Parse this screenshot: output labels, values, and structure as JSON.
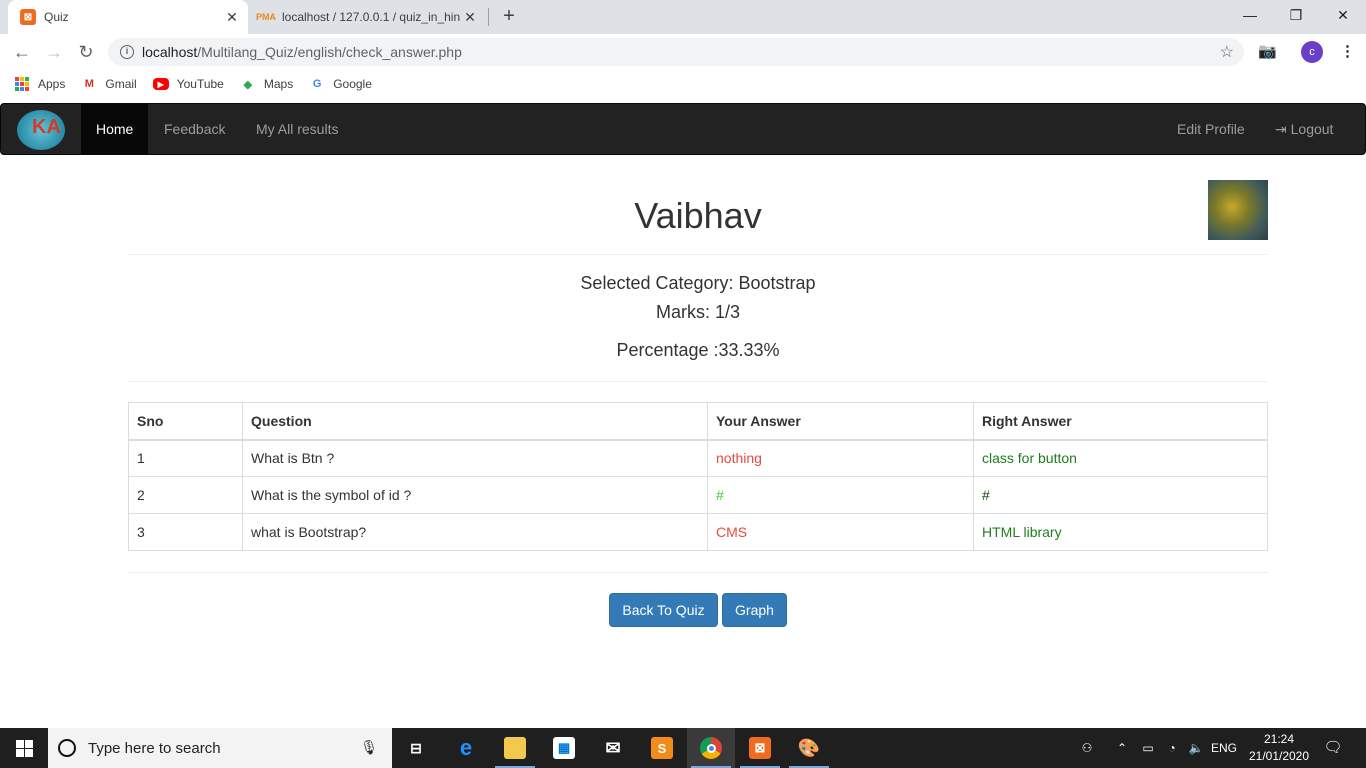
{
  "browser": {
    "tabs": [
      {
        "title": "Quiz",
        "favicon": "xampp-icon"
      },
      {
        "title": "localhost / 127.0.0.1 / quiz_in_hin",
        "favicon": "phpmyadmin-icon"
      }
    ],
    "url_host": "localhost",
    "url_path": "/Multilang_Quiz/english/check_answer.php",
    "profile_initial": "c",
    "bookmarks": [
      {
        "label": "Apps",
        "icon": "apps-grid-icon"
      },
      {
        "label": "Gmail",
        "icon": "gmail-icon"
      },
      {
        "label": "YouTube",
        "icon": "youtube-icon"
      },
      {
        "label": "Maps",
        "icon": "maps-icon"
      },
      {
        "label": "Google",
        "icon": "google-icon"
      }
    ]
  },
  "navbar": {
    "items": [
      "Home",
      "Feedback",
      "My All results"
    ],
    "right_items": [
      "Edit Profile",
      "Logout"
    ],
    "active_color": "#080808",
    "bg_color": "#222222"
  },
  "profile": {
    "username": "Vaibhav"
  },
  "summary": {
    "category": "Selected Category: Bootstrap",
    "marks": "Marks: 1/3",
    "percentage": "Percentage :33.33%"
  },
  "results_table": {
    "headers": [
      "Sno",
      "Question",
      "Your Answer",
      "Right Answer"
    ],
    "rows": [
      {
        "sno": "1",
        "question": "What is Btn ?",
        "your_answer": "nothing",
        "right_answer": "class for button"
      },
      {
        "sno": "2",
        "question": "What is the symbol of id ?",
        "your_answer": "#",
        "right_answer": "#"
      },
      {
        "sno": "3",
        "question": "what is Bootstrap?",
        "your_answer": "CMS",
        "right_answer": "HTML library"
      }
    ]
  },
  "buttons": {
    "back": "Back To Quiz",
    "graph": "Graph",
    "color": "#337ab7"
  },
  "taskbar": {
    "search_placeholder": "Type here to search",
    "language": "ENG",
    "time": "21:24",
    "date": "21/01/2020"
  }
}
